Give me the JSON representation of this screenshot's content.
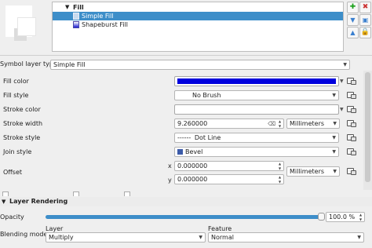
{
  "tree": {
    "root_label": "Fill",
    "items": [
      {
        "label": "Simple Fill",
        "selected": true
      },
      {
        "label": "Shapeburst Fill",
        "selected": false
      }
    ]
  },
  "side_buttons": {
    "add": "✚",
    "move_down": "▼",
    "move_up": "▲",
    "remove": "✖",
    "duplicate": "▣",
    "lock": "🔒"
  },
  "symbol_layer_type": {
    "label": "Symbol layer type",
    "value": "Simple Fill"
  },
  "properties": {
    "fill_color": {
      "label": "Fill color",
      "color": "#0000dd"
    },
    "fill_style": {
      "label": "Fill style",
      "value": "No Brush"
    },
    "stroke_color": {
      "label": "Stroke color",
      "color": "#ffffff"
    },
    "stroke_width": {
      "label": "Stroke width",
      "value": "9.260000",
      "unit": "Millimeters"
    },
    "stroke_style": {
      "label": "Stroke style",
      "value": "Dot Line",
      "preview": "------"
    },
    "join_style": {
      "label": "Join style",
      "value": "Bevel"
    },
    "offset": {
      "label": "Offset",
      "x_label": "x",
      "x_value": "0.000000",
      "y_label": "y",
      "y_value": "0.000000",
      "unit": "Millimeters"
    }
  },
  "layer_rendering": {
    "title": "Layer Rendering",
    "opacity": {
      "label": "Opacity",
      "value": "100.0 %",
      "level": 1.0
    },
    "blending_mode": {
      "label": "Blending mode",
      "layer_label": "Layer",
      "layer_value": "Multiply",
      "feature_label": "Feature",
      "feature_value": "Normal"
    }
  },
  "colors": {
    "accent": "#3d8ec9",
    "fill": "#0000dd"
  }
}
